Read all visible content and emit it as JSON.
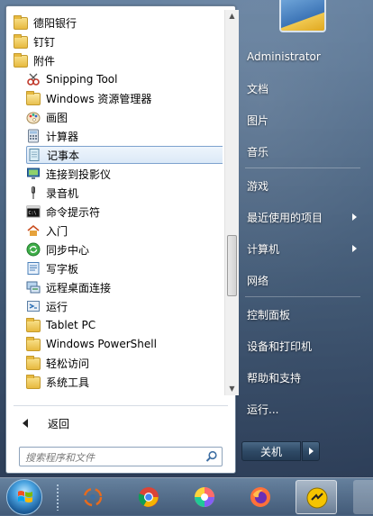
{
  "programs": [
    {
      "label": "德阳银行",
      "icon": "folder-icon",
      "indent": false,
      "selected": false
    },
    {
      "label": "钉钉",
      "icon": "folder-icon",
      "indent": false,
      "selected": false
    },
    {
      "label": "附件",
      "icon": "folder-icon",
      "indent": false,
      "selected": false
    },
    {
      "label": "Snipping Tool",
      "icon": "snipping-tool-icon",
      "indent": true,
      "selected": false
    },
    {
      "label": "Windows 资源管理器",
      "icon": "explorer-icon",
      "indent": true,
      "selected": false
    },
    {
      "label": "画图",
      "icon": "paint-icon",
      "indent": true,
      "selected": false
    },
    {
      "label": "计算器",
      "icon": "calculator-icon",
      "indent": true,
      "selected": false
    },
    {
      "label": "记事本",
      "icon": "notepad-icon",
      "indent": true,
      "selected": true
    },
    {
      "label": "连接到投影仪",
      "icon": "projector-icon",
      "indent": true,
      "selected": false
    },
    {
      "label": "录音机",
      "icon": "microphone-icon",
      "indent": true,
      "selected": false
    },
    {
      "label": "命令提示符",
      "icon": "cmd-icon",
      "indent": true,
      "selected": false
    },
    {
      "label": "入门",
      "icon": "getting-started-icon",
      "indent": true,
      "selected": false
    },
    {
      "label": "同步中心",
      "icon": "sync-center-icon",
      "indent": true,
      "selected": false
    },
    {
      "label": "写字板",
      "icon": "wordpad-icon",
      "indent": true,
      "selected": false
    },
    {
      "label": "远程桌面连接",
      "icon": "remote-desktop-icon",
      "indent": true,
      "selected": false
    },
    {
      "label": "运行",
      "icon": "run-icon",
      "indent": true,
      "selected": false
    },
    {
      "label": "Tablet PC",
      "icon": "folder-icon",
      "indent": true,
      "selected": false
    },
    {
      "label": "Windows PowerShell",
      "icon": "folder-icon",
      "indent": true,
      "selected": false
    },
    {
      "label": "轻松访问",
      "icon": "folder-icon",
      "indent": true,
      "selected": false
    },
    {
      "label": "系统工具",
      "icon": "folder-icon",
      "indent": true,
      "selected": false
    }
  ],
  "back_label": "返回",
  "search": {
    "placeholder": "搜索程序和文件"
  },
  "right_menu": [
    {
      "label": "Administrator",
      "has_arrow": false
    },
    {
      "label": "文档",
      "has_arrow": false
    },
    {
      "label": "图片",
      "has_arrow": false
    },
    {
      "label": "音乐",
      "has_arrow": false
    },
    {
      "label": "游戏",
      "has_arrow": false
    },
    {
      "label": "最近使用的项目",
      "has_arrow": true
    },
    {
      "label": "计算机",
      "has_arrow": true
    },
    {
      "label": "网络",
      "has_arrow": false
    },
    {
      "label": "控制面板",
      "has_arrow": false
    },
    {
      "label": "设备和打印机",
      "has_arrow": false
    },
    {
      "label": "帮助和支持",
      "has_arrow": false
    },
    {
      "label": "运行...",
      "has_arrow": false
    }
  ],
  "shutdown_label": "关机",
  "taskbar": {
    "items": [
      {
        "name": "start-button",
        "icon": "windows-orb-icon"
      },
      {
        "name": "taskbar-app-1",
        "icon": "spinner-app-icon"
      },
      {
        "name": "taskbar-chrome",
        "icon": "chrome-icon"
      },
      {
        "name": "taskbar-app-color",
        "icon": "color-wheel-icon"
      },
      {
        "name": "taskbar-firefox",
        "icon": "firefox-icon"
      },
      {
        "name": "taskbar-active-app",
        "icon": "yellow-app-icon"
      }
    ]
  },
  "colors": {
    "selection_border": "#7da2ce",
    "folder": "#e7b93f",
    "accent_blue": "#3c74b6"
  }
}
